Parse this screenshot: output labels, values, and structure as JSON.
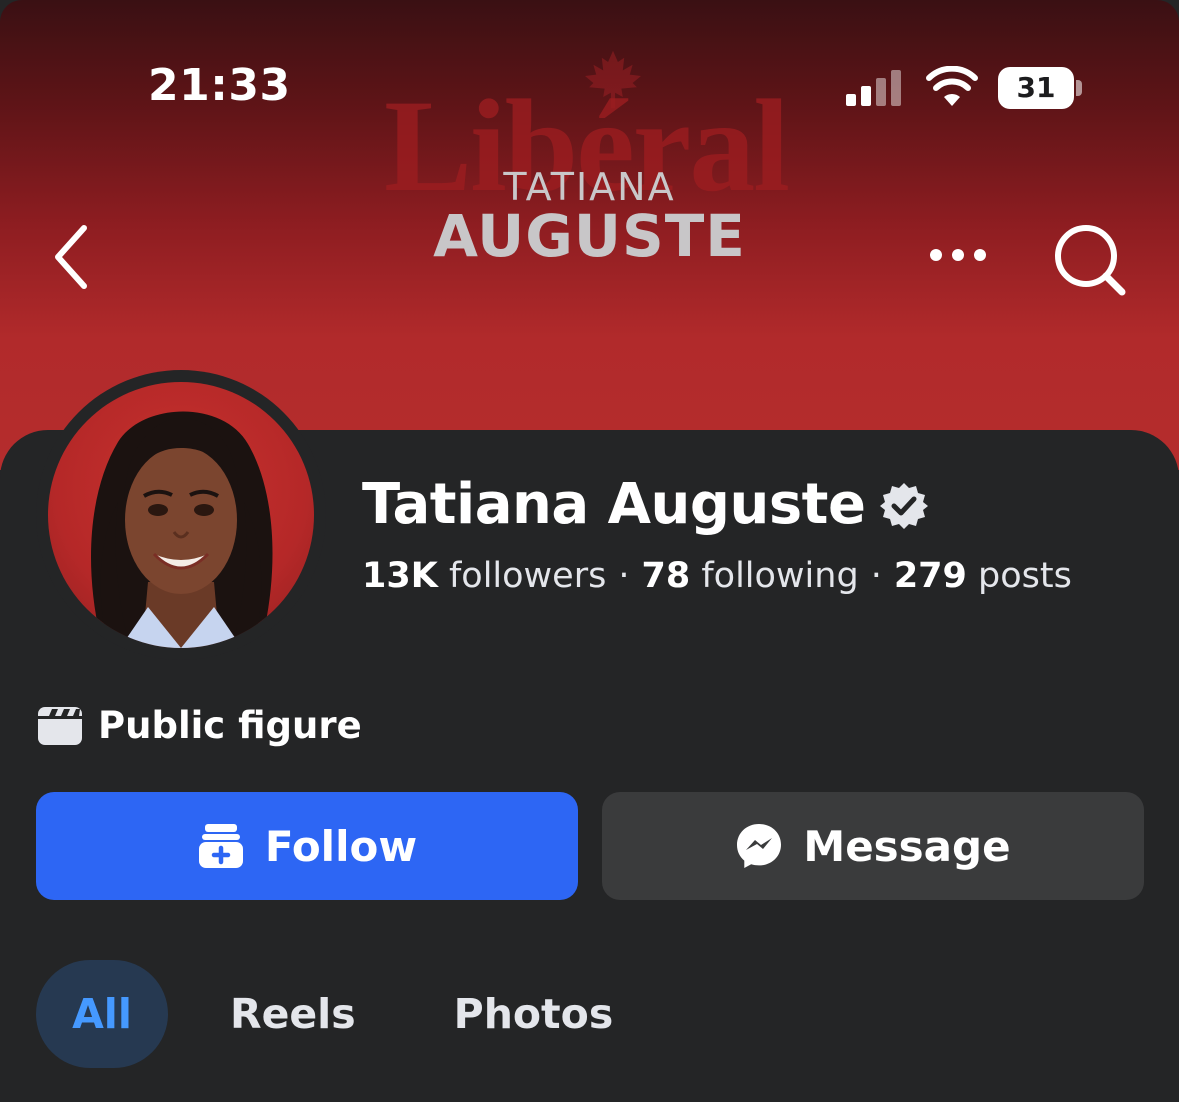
{
  "status_bar": {
    "time": "21:33",
    "battery_level": "31",
    "signal_icon": "cellular-signal-icon",
    "wifi_icon": "wifi-icon"
  },
  "cover": {
    "brand_word": "Libéral",
    "first_name": "TATIANA",
    "last_name": "AUGUSTE",
    "logo_icon": "maple-leaf-icon"
  },
  "nav": {
    "back_icon": "chevron-left-icon",
    "more_icon": "more-horizontal-icon",
    "search_icon": "search-icon"
  },
  "profile": {
    "name": "Tatiana Auguste",
    "verified_icon": "verified-badge-icon",
    "followers_count": "13K",
    "followers_label": " followers",
    "following_count": "78",
    "following_label": " following",
    "posts_count": "279",
    "posts_label": " posts",
    "separator": "·",
    "category": "Public figure",
    "category_icon": "clapperboard-icon"
  },
  "actions": {
    "follow_label": "Follow",
    "follow_icon": "follow-add-icon",
    "message_label": "Message",
    "message_icon": "messenger-icon"
  },
  "tabs": [
    {
      "label": "All",
      "active": true
    },
    {
      "label": "Reels",
      "active": false
    },
    {
      "label": "Photos",
      "active": false
    }
  ],
  "colors": {
    "background": "#242526",
    "follow_button": "#2d66f4",
    "message_button": "#3a3b3c",
    "active_tab_bg": "#263951",
    "active_tab_text": "#4599ff",
    "cover_red": "#b52d2d"
  }
}
